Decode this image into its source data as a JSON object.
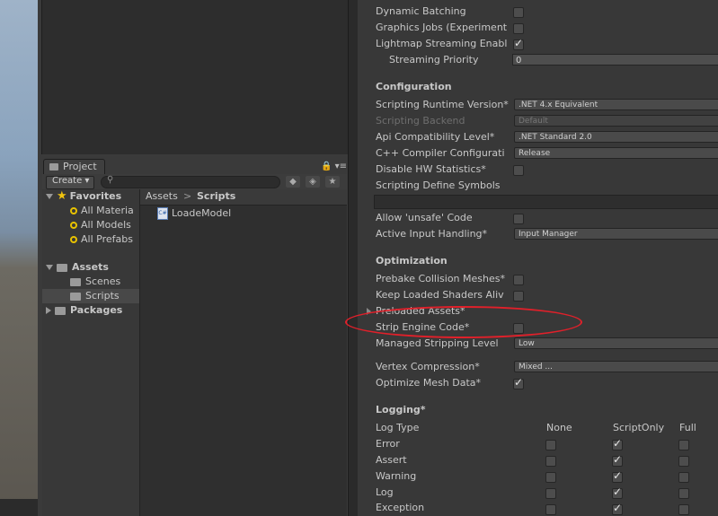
{
  "project_window": {
    "tab_label": "Project",
    "tab_icons": "🔒 ▾≡",
    "create_label": "Create ▾",
    "search_placeholder": "",
    "search_icon": "search-icon",
    "tree": {
      "favorites_label": "Favorites",
      "favorites": [
        "All Materia",
        "All Models",
        "All Prefabs"
      ],
      "assets_label": "Assets",
      "asset_children": [
        "Scenes",
        "Scripts"
      ],
      "packages_label": "Packages"
    },
    "breadcrumb": {
      "root": "Assets",
      "separator": ">",
      "current": "Scripts"
    },
    "files": [
      {
        "name": "LoadeModel",
        "icon": "csharp-script-icon",
        "icon_text": "C#"
      }
    ]
  },
  "inspector": {
    "rows_top": [
      {
        "label": "Dynamic Batching",
        "checked": false
      },
      {
        "label": "Graphics Jobs (Experiment",
        "checked": false
      },
      {
        "label": "Lightmap Streaming Enabl",
        "checked": true
      }
    ],
    "streaming_priority": {
      "label": "Streaming Priority",
      "value": "0"
    },
    "configuration": {
      "title": "Configuration",
      "scripting_runtime": {
        "label": "Scripting Runtime Version*",
        "value": ".NET 4.x Equivalent"
      },
      "scripting_backend": {
        "label": "Scripting Backend",
        "value": "Default"
      },
      "api_compat": {
        "label": "Api Compatibility Level*",
        "value": ".NET Standard 2.0"
      },
      "cpp_config": {
        "label": "C++ Compiler Configurati",
        "value": "Release"
      },
      "disable_hw": {
        "label": "Disable HW Statistics*",
        "checked": false
      },
      "define_symbols": {
        "label": "Scripting Define Symbols",
        "value": ""
      },
      "allow_unsafe": {
        "label": "Allow 'unsafe' Code",
        "checked": false
      },
      "input_handling": {
        "label": "Active Input Handling*",
        "value": "Input Manager"
      }
    },
    "optimization": {
      "title": "Optimization",
      "prebake": {
        "label": "Prebake Collision Meshes*",
        "checked": false
      },
      "keep_shaders": {
        "label": "Keep Loaded Shaders Aliv",
        "checked": false
      },
      "preloaded": {
        "label": "Preloaded Assets*"
      },
      "strip_engine": {
        "label": "Strip Engine Code*",
        "checked": false
      },
      "managed_stripping": {
        "label": "Managed Stripping Level",
        "value": "Low"
      },
      "vertex_compression": {
        "label": "Vertex Compression*",
        "value": "Mixed ..."
      },
      "optimize_mesh": {
        "label": "Optimize Mesh Data*",
        "checked": true
      }
    },
    "logging": {
      "title": "Logging*",
      "header": {
        "label": "Log Type",
        "cols": [
          "None",
          "ScriptOnly",
          "Full"
        ]
      },
      "rows": [
        {
          "label": "Error",
          "none": false,
          "script_only": true,
          "full": false
        },
        {
          "label": "Assert",
          "none": false,
          "script_only": true,
          "full": false
        },
        {
          "label": "Warning",
          "none": false,
          "script_only": true,
          "full": false
        },
        {
          "label": "Log",
          "none": false,
          "script_only": true,
          "full": false
        },
        {
          "label": "Exception",
          "none": false,
          "script_only": true,
          "full": false
        }
      ]
    },
    "highlight_color": "#e0202a"
  }
}
